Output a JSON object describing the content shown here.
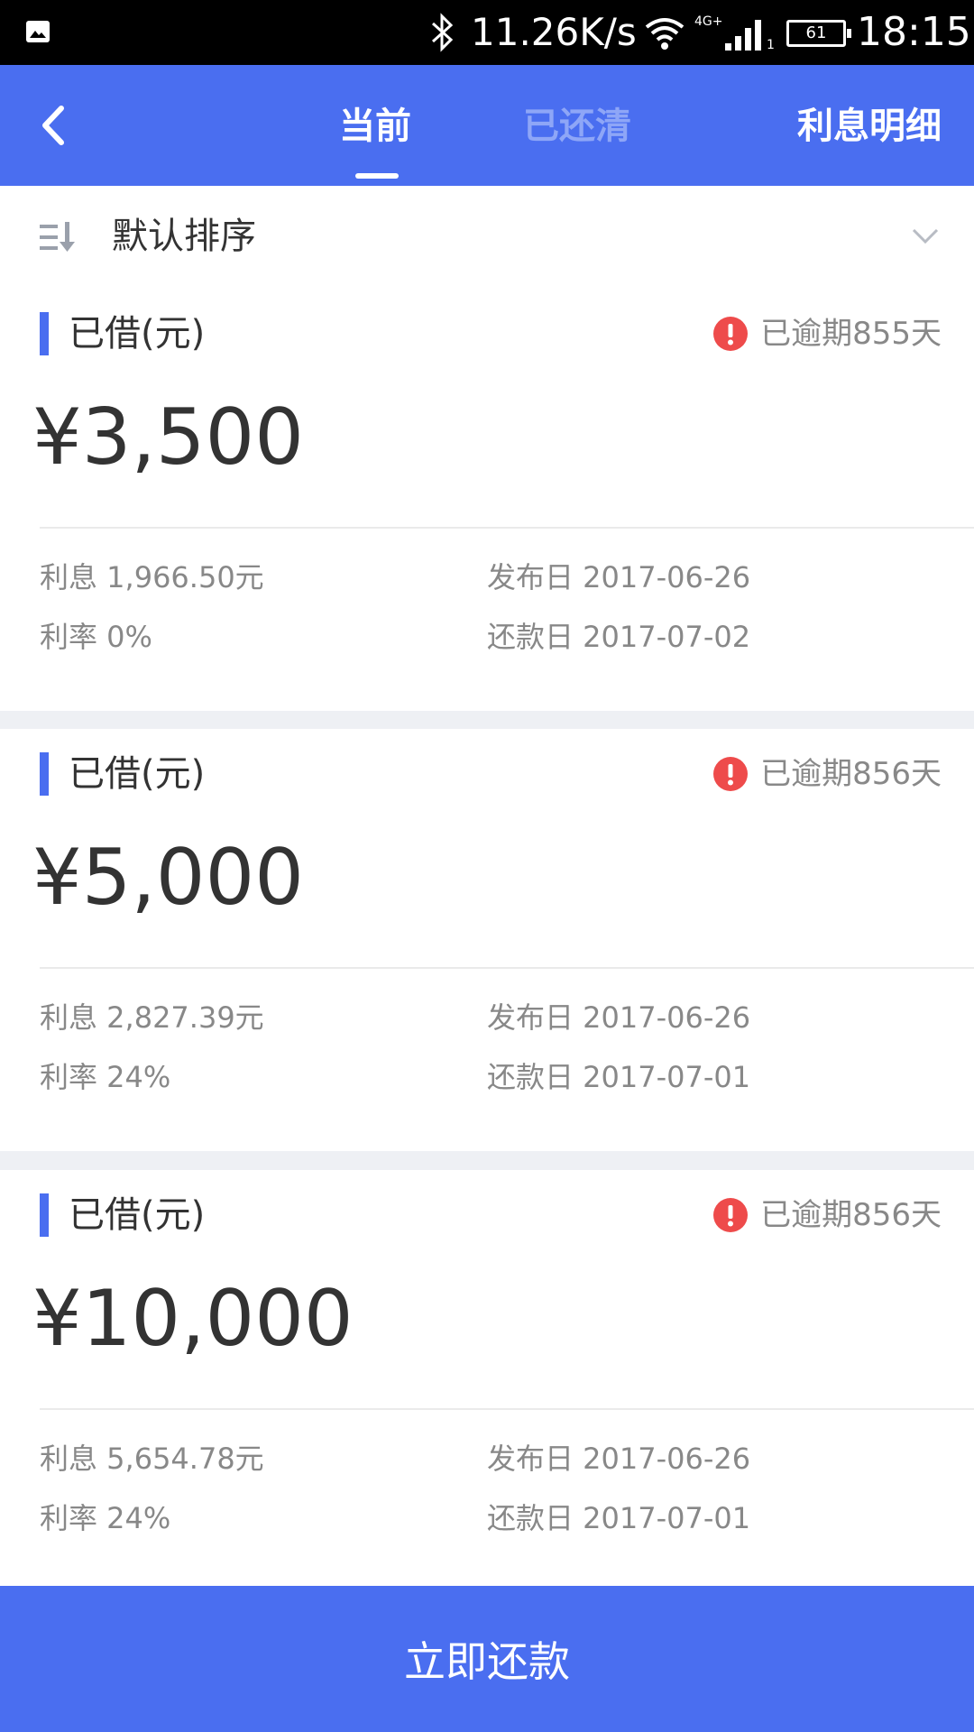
{
  "status_bar": {
    "speed": "11.26K/s",
    "network": "4G+",
    "sim": "1",
    "battery": "61",
    "time": "18:15"
  },
  "nav": {
    "tabs": [
      {
        "label": "当前",
        "active": true
      },
      {
        "label": "已还清",
        "active": false
      }
    ],
    "interest_detail": "利息明细"
  },
  "sort": {
    "label": "默认排序"
  },
  "loans": [
    {
      "borrowed_label": "已借(元)",
      "overdue": "已逾期855天",
      "amount": "¥3,500",
      "interest": "利息 1,966.50元",
      "rate": "利率 0%",
      "issue_date": "发布日 2017-06-26",
      "due_date": "还款日 2017-07-02"
    },
    {
      "borrowed_label": "已借(元)",
      "overdue": "已逾期856天",
      "amount": "¥5,000",
      "interest": "利息 2,827.39元",
      "rate": "利率 24%",
      "issue_date": "发布日 2017-06-26",
      "due_date": "还款日 2017-07-01"
    },
    {
      "borrowed_label": "已借(元)",
      "overdue": "已逾期856天",
      "amount": "¥10,000",
      "interest": "利息 5,654.78元",
      "rate": "利率 24%",
      "issue_date": "发布日 2017-06-26",
      "due_date": "还款日 2017-07-01"
    }
  ],
  "repay_button": "立即还款",
  "colors": {
    "accent": "#4a6ef0",
    "warning": "#ee4b4b",
    "background": "#eef0f4"
  }
}
